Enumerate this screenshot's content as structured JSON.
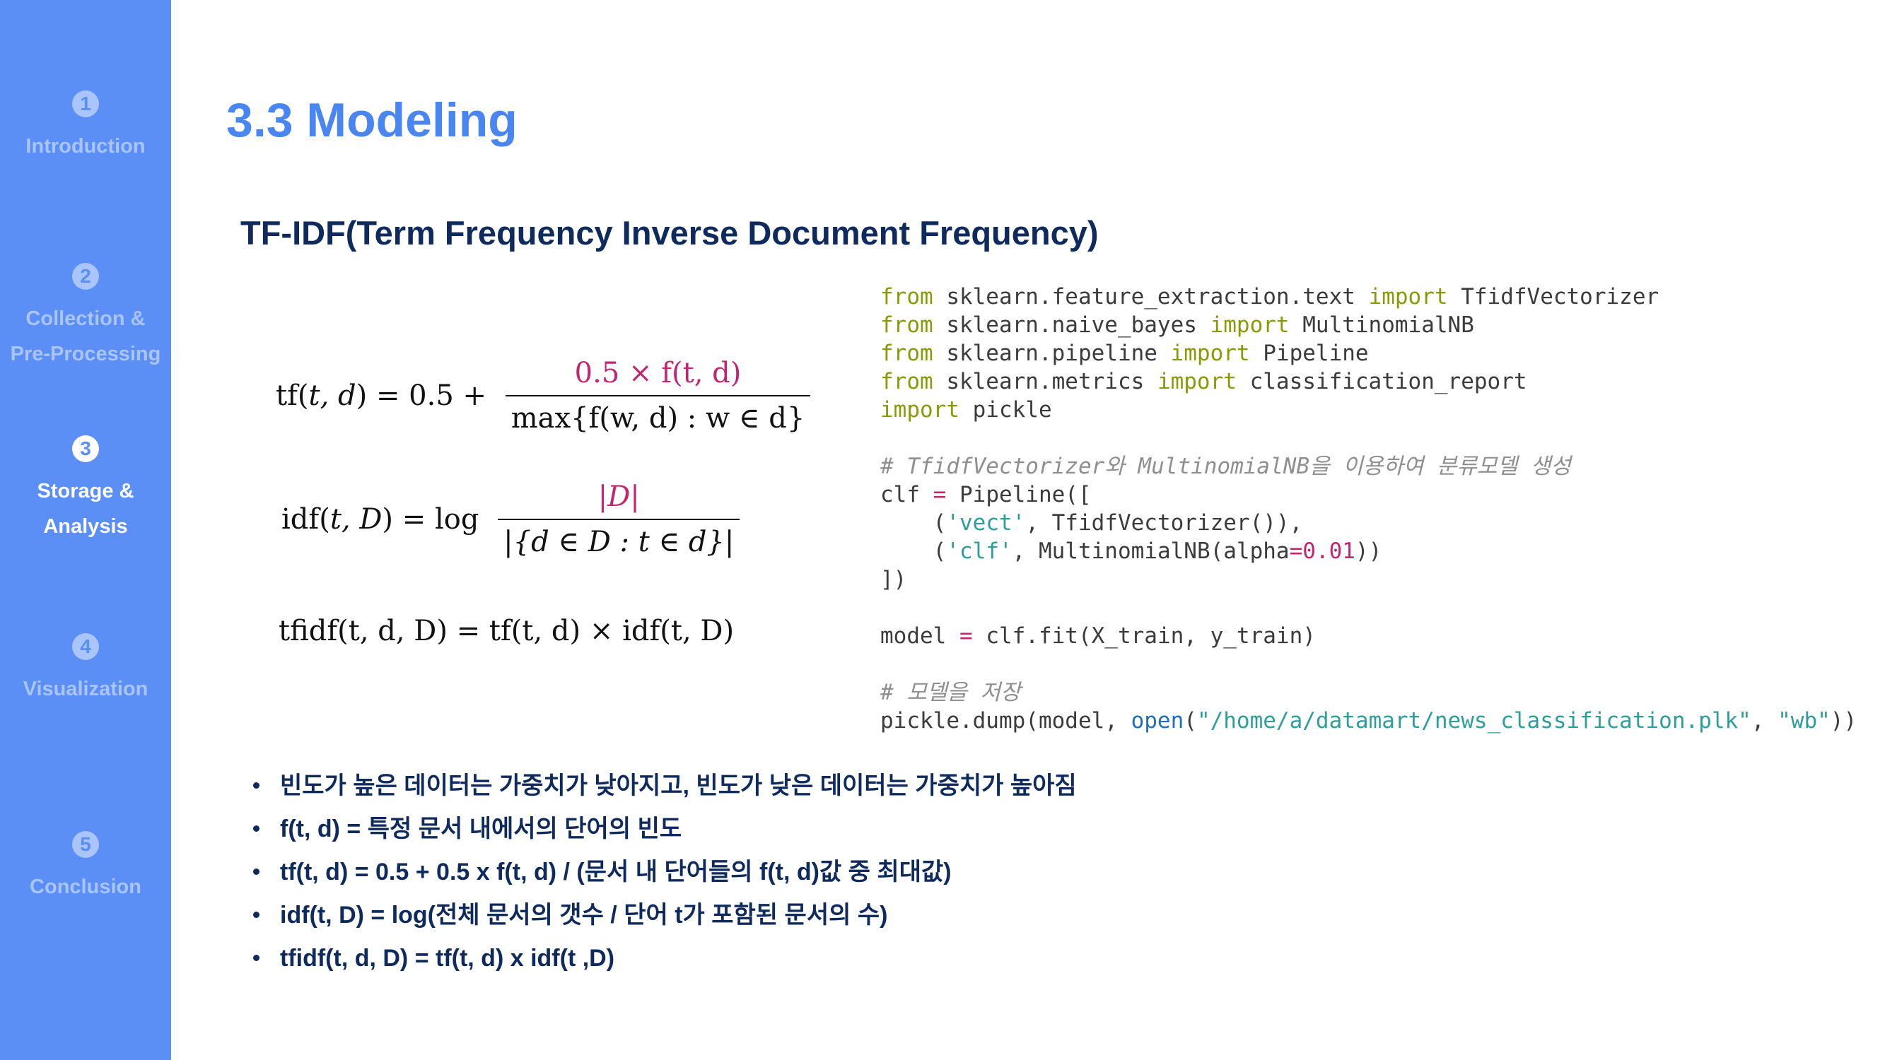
{
  "sidebar": {
    "items": [
      {
        "num": "1",
        "label1": "Introduction",
        "label2": ""
      },
      {
        "num": "2",
        "label1": "Collection &",
        "label2": "Pre-Processing"
      },
      {
        "num": "3",
        "label1": "Storage &",
        "label2": "Analysis"
      },
      {
        "num": "4",
        "label1": "Visualization",
        "label2": ""
      },
      {
        "num": "5",
        "label1": "Conclusion",
        "label2": ""
      }
    ],
    "active_index": 2,
    "colors": {
      "background": "#5b8ff5",
      "active_text": "#ffffff",
      "inactive_text": "#a9c5fb"
    }
  },
  "main": {
    "page_title": "3.3 Modeling",
    "section_title": "TF-IDF(Term Frequency Inverse Document Frequency)",
    "formulas": {
      "tf": {
        "lhs_fn": "tf",
        "lhs_args": "t, d",
        "lhs_eq": "= 0.5 +",
        "num": "0.5 × f(t, d)",
        "den": "max{f(w, d) : w ∈ d}"
      },
      "idf": {
        "lhs_fn": "idf",
        "lhs_args": "t, D",
        "lhs_eq": "= log",
        "num": "|D|",
        "den": "|{d ∈ D : t ∈ d}|"
      },
      "tfidf": {
        "text": "tfidf(t, d, D) = tf(t, d) × idf(t, D)"
      }
    },
    "code": {
      "l1_a": "from",
      "l1_b": " sklearn.feature_extraction.text ",
      "l1_c": "import",
      "l1_d": " TfidfVectorizer",
      "l2_a": "from",
      "l2_b": " sklearn.naive_bayes ",
      "l2_c": "import",
      "l2_d": " MultinomialNB",
      "l3_a": "from",
      "l3_b": " sklearn.pipeline ",
      "l3_c": "import",
      "l3_d": " Pipeline",
      "l4_a": "from",
      "l4_b": " sklearn.metrics ",
      "l4_c": "import",
      "l4_d": " classification_report",
      "l5_a": "import",
      "l5_b": " pickle",
      "l6_comment": "# TfidfVectorizer와 MultinomialNB을 이용하여 분류모델 생성",
      "l7_a": "clf ",
      "l7_b": "=",
      "l7_c": " Pipeline([",
      "l8_a": "    (",
      "l8_b": "'vect'",
      "l8_c": ", TfidfVectorizer()),",
      "l9_a": "    (",
      "l9_b": "'clf'",
      "l9_c": ", MultinomialNB(alpha",
      "l9_d": "=",
      "l9_e": "0.01",
      "l9_f": "))",
      "l10": "])",
      "l11_a": "model ",
      "l11_b": "=",
      "l11_c": " clf.fit(X_train, y_train)",
      "l12_comment": "# 모델을 저장",
      "l13_a": "pickle.dump(model, ",
      "l13_b": "open",
      "l13_c": "(",
      "l13_d": "\"/home/a/datamart/news_classification.plk\"",
      "l13_e": ", ",
      "l13_f": "\"wb\"",
      "l13_g": "))"
    },
    "bullets": [
      "빈도가 높은 데이터는 가중치가 낮아지고, 빈도가 낮은 데이터는 가중치가 높아짐",
      "f(t, d) = 특정 문서 내에서의 단어의 빈도",
      "tf(t, d) = 0.5 + 0.5 x f(t, d) / (문서 내 단어들의 f(t, d)값 중 최대값)",
      "idf(t, D) = log(전체 문서의 갯수 / 단어 t가 포함된 문서의 수)",
      "tfidf(t, d, D) = tf(t, d) x idf(t ,D)"
    ]
  }
}
